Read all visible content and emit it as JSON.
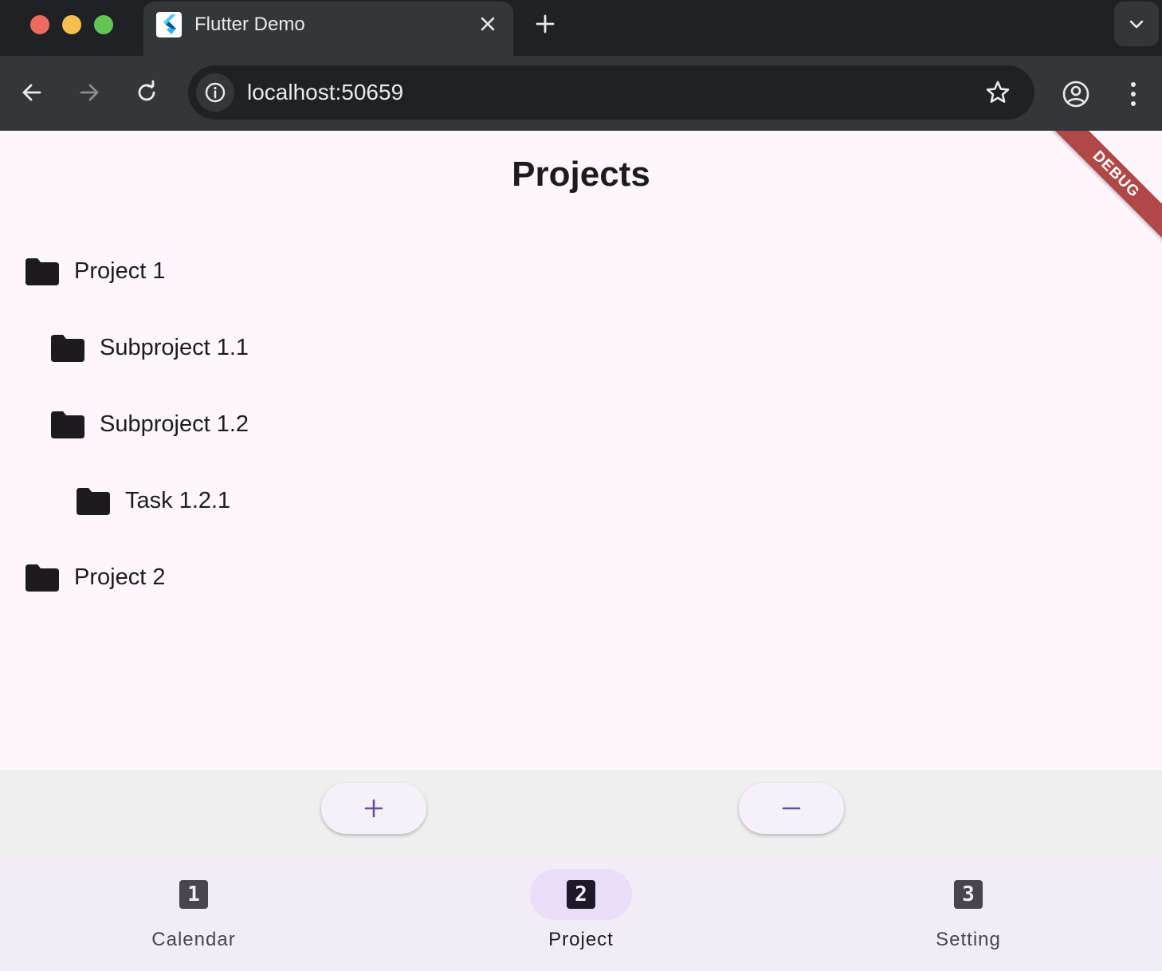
{
  "browser": {
    "tab_title": "Flutter Demo",
    "url": "localhost:50659"
  },
  "app": {
    "title": "Projects",
    "debug_banner": "DEBUG",
    "tree": [
      {
        "label": "Project 1",
        "depth": 0
      },
      {
        "label": "Subproject 1.1",
        "depth": 1
      },
      {
        "label": "Subproject 1.2",
        "depth": 1
      },
      {
        "label": "Task 1.2.1",
        "depth": 2
      },
      {
        "label": "Project 2",
        "depth": 0
      }
    ],
    "fabs": [
      {
        "name": "add-button",
        "icon": "plus-icon"
      },
      {
        "name": "remove-button",
        "icon": "minus-icon"
      }
    ],
    "nav": {
      "selected_index": 1,
      "items": [
        {
          "label": "Calendar",
          "icon_text": "1"
        },
        {
          "label": "Project",
          "icon_text": "2"
        },
        {
          "label": "Setting",
          "icon_text": "3"
        }
      ]
    }
  },
  "colors": {
    "accent": "#6750a4",
    "nav_indicator": "#e8def8",
    "debug_banner": "#b04848",
    "background": "#fdf7fd"
  }
}
